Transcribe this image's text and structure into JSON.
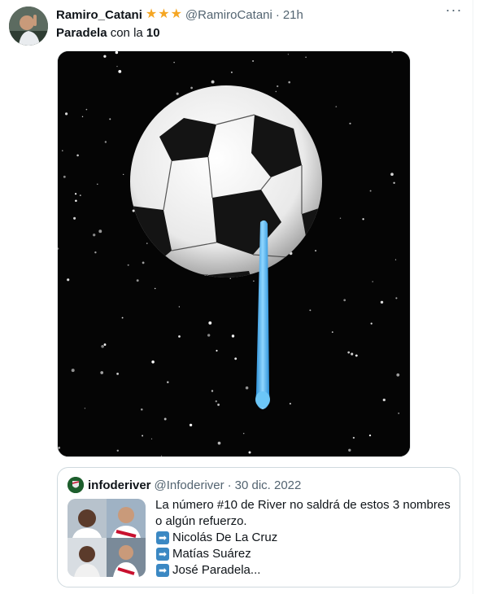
{
  "tweet": {
    "display_name": "Ramiro_Catani",
    "badges": [
      "star",
      "star",
      "star"
    ],
    "handle": "@RamiroCatani",
    "separator": "·",
    "time": "21h",
    "more_label": "···",
    "text_part1": "Paradela",
    "text_part2": " con la ",
    "text_part3": "10"
  },
  "media": {
    "description_icon": "soccer-ball-in-space-icon",
    "ball_color": "#ffffff",
    "tear_color": "#4fb4f0",
    "background_color": "#050505"
  },
  "quote": {
    "display_name": "infoderiver",
    "handle": "@Infoderiver",
    "separator": "·",
    "date": "30 dic. 2022",
    "line1": "La número #10 de River no saldrá de estos 3 nombres",
    "line2": "o algún refuerzo.",
    "items": [
      {
        "icon": "➡",
        "label": "Nicolás De La Cruz"
      },
      {
        "icon": "➡",
        "label": "Matías Suárez"
      },
      {
        "icon": "➡",
        "label": "José Paradela..."
      }
    ]
  },
  "colors": {
    "accent": "#1d9bf0",
    "secondary_text": "#536471",
    "border": "#cfd9de",
    "star": "#f5a623",
    "arrow_box": "#3b88c3"
  }
}
